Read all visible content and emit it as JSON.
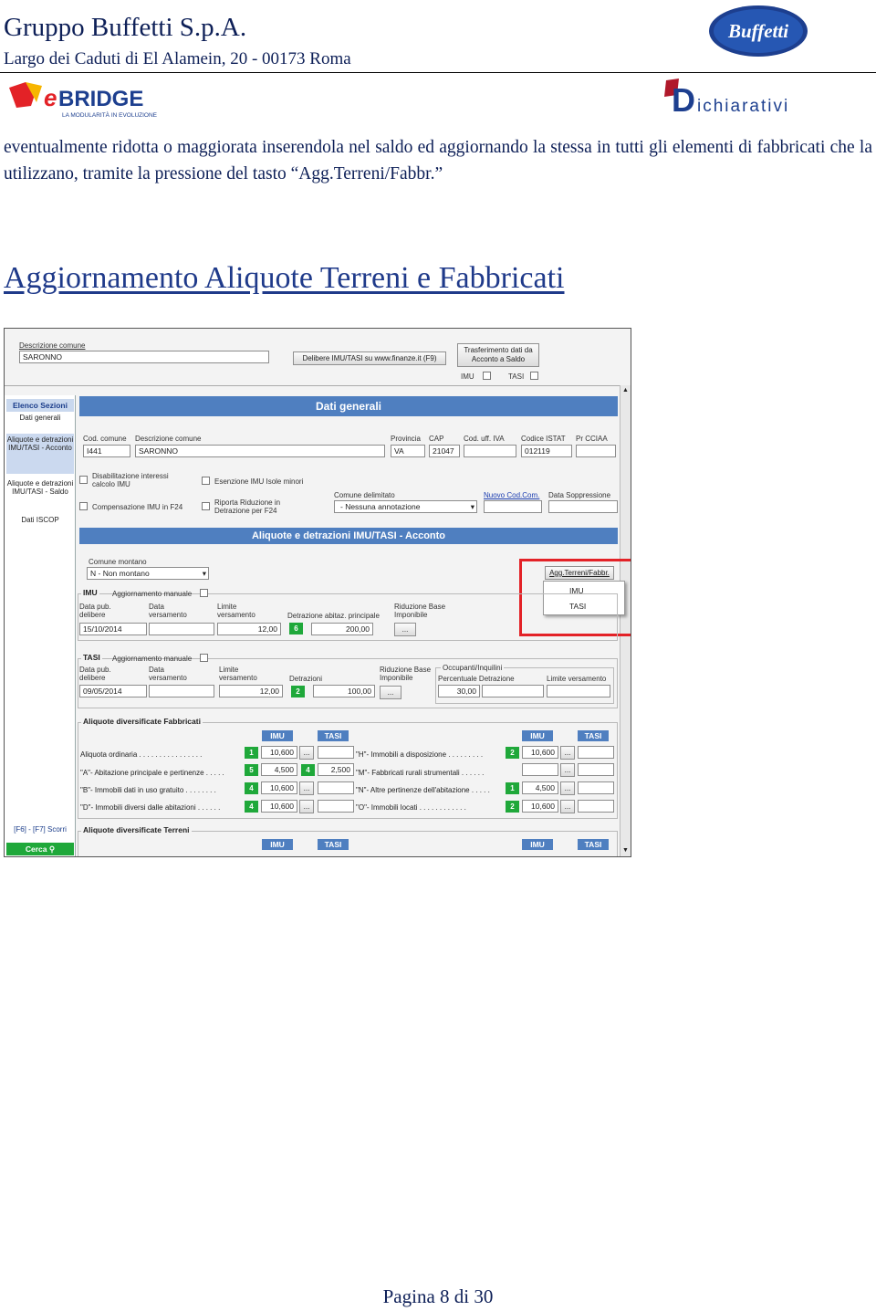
{
  "header": {
    "company": "Gruppo Buffetti S.p.A.",
    "address": "Largo dei Caduti di El Alamein, 20 - 00173 Roma",
    "logo_buffetti": "Buffetti",
    "logo_ebridge": "eBRIDGE",
    "logo_ebridge_tagline": "LA MODULARITÀ IN EVOLUZIONE",
    "logo_dichiarativi": "ichiarativi"
  },
  "intro_text": "eventualmente ridotta o maggiorata inserendola nel saldo ed aggiornando la stessa in tutti gli elementi di fabbricati che la utilizzano, tramite la pressione del tasto “Agg.Terreni/Fabbr.”",
  "section_title": "Aggiornamento Aliquote Terreni e Fabbricati",
  "footer": "Pagina 8 di 30",
  "screenshot": {
    "top": {
      "descr_label": "Descrizione comune",
      "descr_value": "SARONNO",
      "delibere_btn": "Delibere IMU/TASI su www.finanze.it (F9)",
      "trasf_btn": "Trasferimento dati da Acconto a Saldo",
      "imu_label": "IMU",
      "tasi_label": "TASI"
    },
    "sidebar": {
      "head": "Elenco Sezioni",
      "items": [
        "Dati generali",
        "Aliquote e detrazioni IMU/TASI - Acconto",
        "Aliquote e detrazioni IMU/TASI - Saldo",
        "Dati ISCOP"
      ],
      "shortcut": "[F6] - [F7] Scorri",
      "cerca": "Cerca"
    },
    "dati_generali": {
      "title": "Dati generali",
      "labels": [
        "Cod. comune",
        "Descrizione comune",
        "Provincia",
        "CAP",
        "Cod. uff. IVA",
        "Codice ISTAT",
        "Pr CCIAA"
      ],
      "values": [
        "I441",
        "SARONNO",
        "VA",
        "21047",
        "",
        "012119",
        ""
      ],
      "chk_disab": "Disabilitazione interessi calcolo IMU",
      "chk_esenz": "Esenzione IMU Isole minori",
      "chk_comp": "Compensazione IMU in F24",
      "chk_riporta": "Riporta Riduzione in Detrazione per F24",
      "comune_delim_label": "Comune delimitato",
      "comune_delim_value": "- Nessuna annotazione",
      "nuovo_cod": "Nuovo Cod.Com.",
      "data_soppr": "Data Soppressione"
    },
    "acconto": {
      "title": "Aliquote e detrazioni IMU/TASI - Acconto",
      "comune_montano_label": "Comune montano",
      "comune_montano_value": "N - Non montano",
      "agg_btn": "Agg.Terreni/Fabbr.",
      "popup": [
        "IMU",
        "TASI"
      ],
      "imu": {
        "title": "IMU",
        "agg_man": "Aggiornamento manuale",
        "col_data_pub": "Data pub. delibere",
        "col_data_vers": "Data versamento",
        "col_limite": "Limite versamento",
        "col_detr": "Detrazione abitaz. principale",
        "col_rid": "Riduzione Base Imponibile",
        "data_pub": "15/10/2014",
        "data_vers": "",
        "limite": "12,00",
        "detr_code": "6",
        "detr": "200,00"
      },
      "tasi": {
        "title": "TASI",
        "agg_man": "Aggiornamento manuale",
        "col_data_pub": "Data pub. delibere",
        "col_data_vers": "Data versamento",
        "col_limite": "Limite versamento",
        "col_detr": "Detrazioni",
        "col_rid": "Riduzione Base Imponibile",
        "occupanti": "Occupanti/Inquilini",
        "col_perc": "Percentuale Detrazione",
        "col_limite2": "Limite versamento",
        "data_pub": "09/05/2014",
        "limite": "12,00",
        "detr_code": "2",
        "detr": "100,00",
        "perc": "30,00"
      }
    },
    "fabbricati": {
      "title": "Aliquote diversificate Fabbricati",
      "imu": "IMU",
      "tasi": "TASI",
      "left_rows": [
        {
          "label": "Aliquota ordinaria . . . . . . . . . . . . . . . .",
          "code": "1",
          "imu": "10,600",
          "tasi_code": "",
          "tasi": ""
        },
        {
          "label": "\"A\"- Abitazione principale e pertinenze . . . . .",
          "code": "5",
          "imu": "4,500",
          "tasi_code": "4",
          "tasi": "2,500"
        },
        {
          "label": "\"B\"- Immobili dati in uso gratuito . . . . . . . .",
          "code": "4",
          "imu": "10,600",
          "tasi_code": "",
          "tasi": ""
        },
        {
          "label": "\"D\"- Immobili diversi dalle abitazioni . . . . . .",
          "code": "4",
          "imu": "10,600",
          "tasi_code": "",
          "tasi": ""
        }
      ],
      "right_rows": [
        {
          "label": "\"H\"- Immobili a disposizione . . . . . . . . .",
          "code": "2",
          "imu": "10,600"
        },
        {
          "label": "\"M\"- Fabbricati rurali strumentali . . . . . .",
          "code": "",
          "imu": ""
        },
        {
          "label": "\"N\"- Altre pertinenze dell'abitazione . . . . .",
          "code": "1",
          "imu": "4,500"
        },
        {
          "label": "\"O\"- Immobili locati . . . . . . . . . . . .",
          "code": "2",
          "imu": "10,600"
        }
      ]
    },
    "terreni": {
      "title": "Aliquote diversificate Terreni",
      "imu": "IMU",
      "tasi": "TASI"
    }
  }
}
